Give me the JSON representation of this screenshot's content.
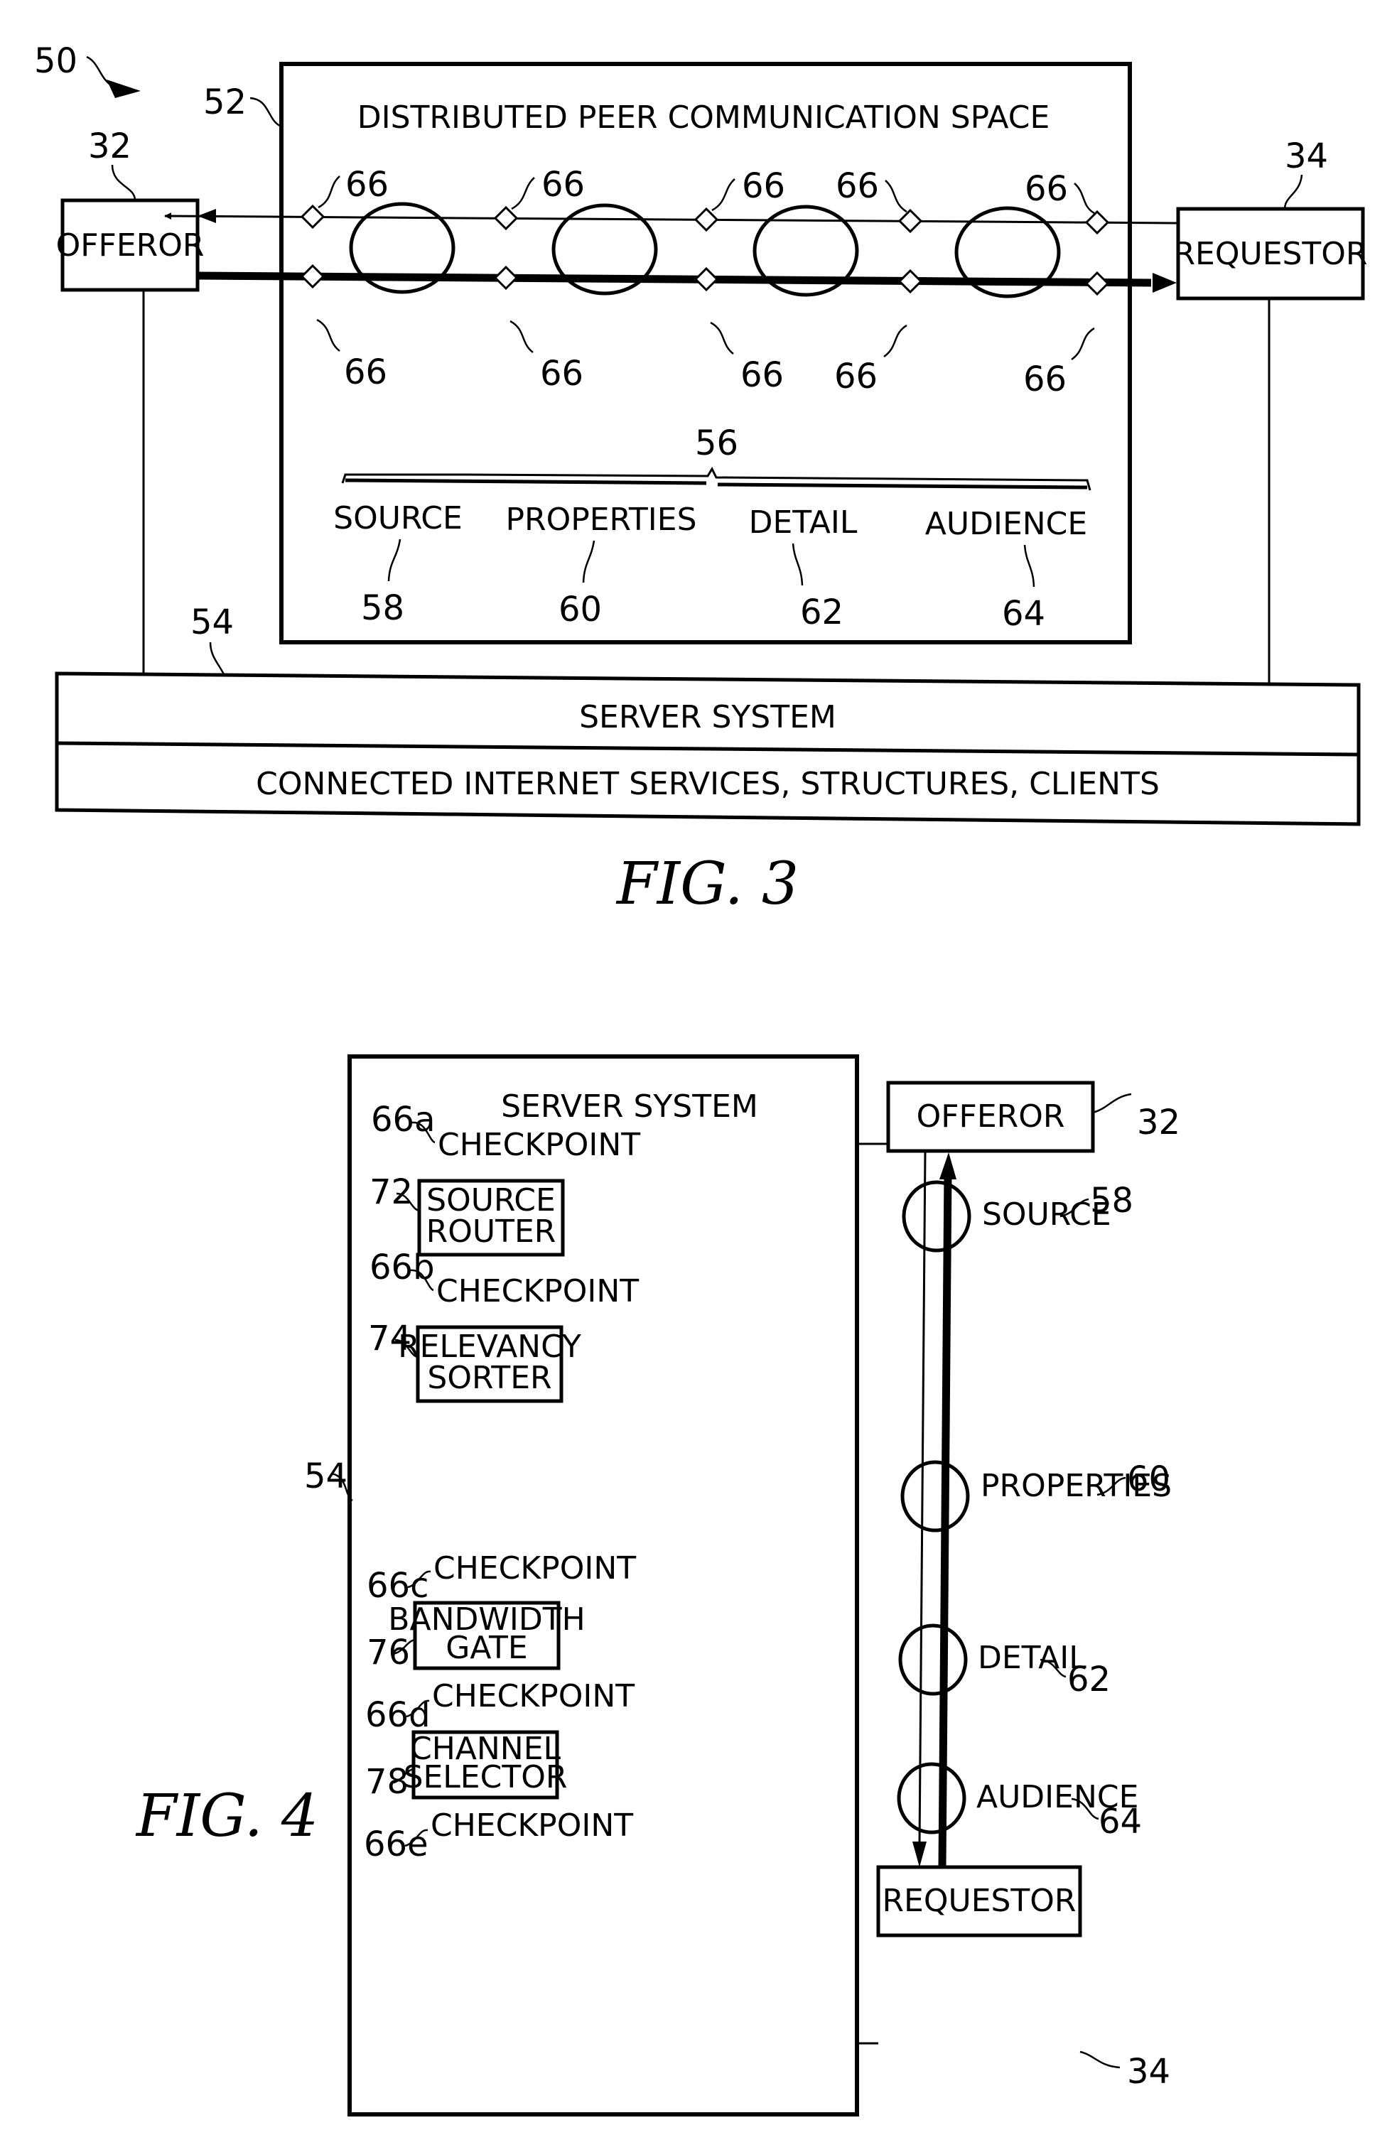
{
  "fig3": {
    "caption": "FIG. 3",
    "system_ref": "50",
    "space": {
      "title": "DISTRIBUTED PEER COMMUNICATION SPACE",
      "ref": "52"
    },
    "offeror": {
      "label": "OFFEROR",
      "ref": "32"
    },
    "requestor": {
      "label": "REQUESTOR",
      "ref": "34"
    },
    "checkpoint_ref": "66",
    "attributes_ref": "56",
    "attributes": [
      {
        "label": "SOURCE",
        "ref": "58"
      },
      {
        "label": "PROPERTIES",
        "ref": "60"
      },
      {
        "label": "DETAIL",
        "ref": "62"
      },
      {
        "label": "AUDIENCE",
        "ref": "64"
      }
    ],
    "server": {
      "ref": "54",
      "row1": "SERVER SYSTEM",
      "row2": "CONNECTED INTERNET SERVICES, STRUCTURES, CLIENTS"
    }
  },
  "fig4": {
    "caption": "FIG. 4",
    "server": {
      "title": "SERVER SYSTEM",
      "ref": "54"
    },
    "checkpoints": [
      {
        "label": "CHECKPOINT",
        "ref": "66a"
      },
      {
        "label": "CHECKPOINT",
        "ref": "66b"
      },
      {
        "label": "CHECKPOINT",
        "ref": "66c"
      },
      {
        "label": "CHECKPOINT",
        "ref": "66d"
      },
      {
        "label": "CHECKPOINT",
        "ref": "66e"
      }
    ],
    "modules": [
      {
        "line1": "SOURCE",
        "line2": "ROUTER",
        "ref": "72"
      },
      {
        "line1": "RELEVANCY",
        "line2": "SORTER",
        "ref": "74"
      },
      {
        "line1": "BANDWIDTH",
        "line2": "GATE",
        "ref": "76"
      },
      {
        "line1": "CHANNEL",
        "line2": "SELECTOR",
        "ref": "78"
      }
    ],
    "offeror": {
      "label": "OFFEROR",
      "ref": "32"
    },
    "requestor": {
      "label": "REQUESTOR",
      "ref": "34"
    },
    "attributes": [
      {
        "label": "SOURCE",
        "ref": "58"
      },
      {
        "label": "PROPERTIES",
        "ref": "60"
      },
      {
        "label": "DETAIL",
        "ref": "62"
      },
      {
        "label": "AUDIENCE",
        "ref": "64"
      }
    ]
  }
}
